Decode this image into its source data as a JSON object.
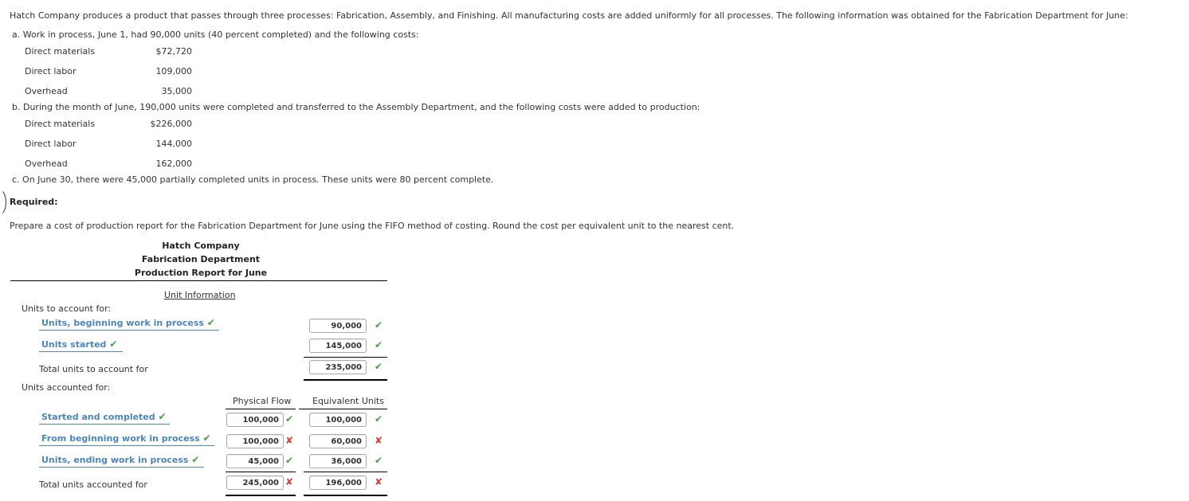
{
  "problem": {
    "intro": "Hatch Company produces a product that passes through three processes: Fabrication, Assembly, and Finishing. All manufacturing costs are added uniformly for all processes. The following information was obtained for the Fabrication Department for June:",
    "a": {
      "text": "a. Work in process, June 1, had 90,000 units (40 percent completed) and the following costs:",
      "rows": [
        {
          "label": "Direct materials",
          "value": "$72,720"
        },
        {
          "label": "Direct labor",
          "value": "109,000"
        },
        {
          "label": "Overhead",
          "value": "35,000"
        }
      ]
    },
    "b": {
      "text": "b. During the month of June, 190,000 units were completed and transferred to the Assembly Department, and the following costs were added to production:",
      "rows": [
        {
          "label": "Direct materials",
          "value": "$226,000"
        },
        {
          "label": "Direct labor",
          "value": "144,000"
        },
        {
          "label": "Overhead",
          "value": "162,000"
        }
      ]
    },
    "c": {
      "text": "c. On June 30, there were 45,000 partially completed units in process. These units were 80 percent complete."
    },
    "required_label": "Required:",
    "instructions": "Prepare a cost of production report for the Fabrication Department for June using the FIFO method of costing. Round the cost per equivalent unit to the nearest cent."
  },
  "report": {
    "title": [
      "Hatch Company",
      "Fabrication Department",
      "Production Report for June"
    ],
    "section_label": "Unit Information",
    "to_account_for": {
      "heading": "Units to account for:",
      "rows": [
        {
          "label": "Units, beginning work in process",
          "label_mark": "✔",
          "value": "90,000",
          "status": "correct"
        },
        {
          "label": "Units started",
          "label_mark": "✔",
          "value": "145,000",
          "status": "correct"
        }
      ],
      "total": {
        "label": "Total units to account for",
        "value": "235,000",
        "status": "correct"
      }
    },
    "accounted_for": {
      "heading": "Units accounted for:",
      "columns": [
        "Physical Flow",
        "Equivalent Units"
      ],
      "rows": [
        {
          "label": "Started and completed",
          "label_mark": "✔",
          "physical": "100,000",
          "physical_status": "correct",
          "equivalent": "100,000",
          "equivalent_status": "correct"
        },
        {
          "label": "From beginning work in process",
          "label_mark": "✔",
          "physical": "100,000",
          "physical_status": "incorrect",
          "equivalent": "60,000",
          "equivalent_status": "incorrect"
        },
        {
          "label": "Units, ending work in process",
          "label_mark": "✔",
          "physical": "45,000",
          "physical_status": "correct",
          "equivalent": "36,000",
          "equivalent_status": "correct"
        }
      ],
      "total": {
        "label": "Total units accounted for",
        "physical": "245,000",
        "physical_status": "incorrect",
        "equivalent": "196,000",
        "equivalent_status": "incorrect"
      }
    },
    "marks": {
      "correct": "✔",
      "incorrect": "✘"
    },
    "colors": {
      "correct": "#43a047",
      "incorrect": "#e53935",
      "link": "#4a86c0"
    }
  }
}
